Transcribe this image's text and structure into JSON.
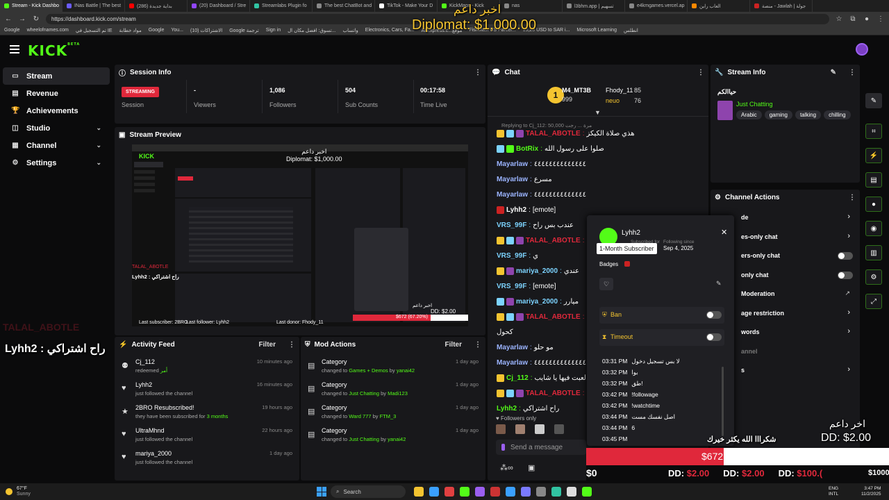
{
  "browser": {
    "tabs": [
      {
        "label": "Stream - Kick Dashbo",
        "color": "#53fc18"
      },
      {
        "label": "INas Battle | The best",
        "color": "#6b5cff"
      },
      {
        "label": "(286) بداية جديدة",
        "color": "#ff0000"
      },
      {
        "label": "(20) Dashboard / Stre",
        "color": "#9146ff"
      },
      {
        "label": "Streamlabs Plugin fo",
        "color": "#31c3a2"
      },
      {
        "label": "The best ChatBot and",
        "color": "#888888"
      },
      {
        "label": "TikTok - Make Your D",
        "color": "#ffffff"
      },
      {
        "label": "KickMaps - Kick",
        "color": "#53fc18"
      },
      {
        "label": "nas",
        "color": "#888888"
      },
      {
        "label": "l3bhm.app | تسهيم",
        "color": "#888888"
      },
      {
        "label": "e4kmgames.vercel.ap",
        "color": "#888888"
      },
      {
        "label": "العاب راين",
        "color": "#ff8800"
      },
      {
        "label": "منصة - Jawlah | جولة",
        "color": "#cc2222"
      }
    ],
    "url": "https://dashboard.kick.com/stream",
    "bookmarks": [
      "Google",
      "wheelofnames.com",
      "تم التسجيل في IE",
      "مواد خطابة",
      "Google",
      "You...",
      "الاشتراكات (10)",
      "Google ترجمة",
      "Sign in",
      "تسوق: افضل مكان ال...",
      "واتساب",
      "Electronics, Cars, Fa...",
      "AliExpress.c...موقع",
      "Fishsfast US Parcel...",
      "15,28 USD to SAR i...",
      "Microsoft Learning",
      "انطلس"
    ]
  },
  "overlay": {
    "donation_top_name": "اخبر داعم",
    "donation_top_amount": "Diplomat: $1,000.00",
    "left_faded": "TALAL_ABOTLE",
    "left_sub_msg": "Lyhh2 : راح اشتراكي",
    "right_label": "اخر داعم",
    "right_amount": "DD: $2.00",
    "thanks": "شكرااا الله يكثر خيرك",
    "goal": "$672 (67.20%)",
    "goal_fraction": 0.672,
    "goal_start": "$0",
    "goal_end": "$1000",
    "ticker": [
      {
        "name": "DD:",
        "amount": "$2.00"
      },
      {
        "name": "DD:",
        "amount": "$2.00"
      },
      {
        "name": "DD:",
        "amount": "$100.("
      }
    ]
  },
  "sidebar": {
    "items": [
      {
        "label": "Stream",
        "icon": "stream-icon",
        "glyph": "▭"
      },
      {
        "label": "Revenue",
        "icon": "revenue-icon",
        "glyph": "▤"
      },
      {
        "label": "Achievements",
        "icon": "trophy-icon",
        "glyph": "🏆"
      },
      {
        "label": "Studio",
        "icon": "studio-icon",
        "glyph": "◫"
      },
      {
        "label": "Channel",
        "icon": "channel-icon",
        "glyph": "▦"
      },
      {
        "label": "Settings",
        "icon": "gear-icon",
        "glyph": "⚙"
      }
    ]
  },
  "session": {
    "title": "Session Info",
    "status": "STREAMING",
    "session_label": "Session",
    "stats": [
      {
        "value": "-",
        "label": "Viewers"
      },
      {
        "value": "1,086",
        "label": "Followers"
      },
      {
        "value": "504",
        "label": "Sub Counts"
      },
      {
        "value": "00:17:58",
        "label": "Time Live"
      }
    ]
  },
  "preview": {
    "title": "Stream Preview",
    "inner_top": "اخبر داعم\nDiplomat: $1,000.00",
    "inner_follower": "Last follower: Lyhh2",
    "inner_donor": "Last donor: Fhody_11",
    "inner_sub": "Last subscriber: 2BRO",
    "inner_goal": "$672 (67.20%)",
    "inner_dd": "DD: $2.00",
    "inner_name": "اخبر داعم",
    "inner_left_user": "TALAL_ABOTLE",
    "inner_lyhh": "Lyhh2 : راح اشتراكي"
  },
  "activity": {
    "title": "Activity Feed",
    "filter": "Filter",
    "items": [
      {
        "name": "Cj_112",
        "sub": "redeemed",
        "extra": "أمر",
        "time": "10 minutes ago",
        "icon": "redeem-icon",
        "glyph": "⚉"
      },
      {
        "name": "Lyhh2",
        "sub": "just followed the channel",
        "extra": "",
        "time": "16 minutes ago",
        "icon": "heart-icon",
        "glyph": "♥"
      },
      {
        "name": "2BRO Resubscribed!",
        "sub": "they have been subscribed for",
        "extra": "3 months",
        "time": "19 hours ago",
        "icon": "star-icon",
        "glyph": "★"
      },
      {
        "name": "UltraMhnd",
        "sub": "just followed the channel",
        "extra": "",
        "time": "22 hours ago",
        "icon": "heart-icon",
        "glyph": "♥"
      },
      {
        "name": "mariya_2000",
        "sub": "just followed the channel",
        "extra": "",
        "time": "1 day ago",
        "icon": "heart-icon",
        "glyph": "♥"
      }
    ]
  },
  "mod": {
    "title": "Mod Actions",
    "filter": "Filter",
    "items": [
      {
        "name": "Category",
        "pre": "changed to",
        "cat": "Games + Demos",
        "by": "by",
        "user": "yanai42",
        "time": "1 day ago"
      },
      {
        "name": "Category",
        "pre": "changed to",
        "cat": "Just Chatting",
        "by": "by",
        "user": "Madi123",
        "time": "1 day ago"
      },
      {
        "name": "Category",
        "pre": "changed to",
        "cat": "Ward 777",
        "by": "by",
        "user": "FTM_3",
        "time": "1 day ago"
      },
      {
        "name": "Category",
        "pre": "changed to",
        "cat": "Just Chatting",
        "by": "by",
        "user": "yanai42",
        "time": "1 day ago"
      }
    ]
  },
  "chat": {
    "title": "Chat",
    "leaders": [
      {
        "name": "M4_MT3B",
        "value": "999"
      },
      {
        "name": "Fhody_11",
        "value": "85"
      },
      {
        "name": "neuo",
        "value": "76"
      }
    ],
    "reply": "Replying to Cj_112: 50,000 مرة ... رجت",
    "messages": [
      {
        "user": "TALAL_ABOTLE",
        "color": "#e0283b",
        "badges": [
          "#f4c430",
          "#7cd3ff",
          "#8e44ad"
        ],
        "text": "هذي صلاة الكيكز"
      },
      {
        "user": "BotRix",
        "color": "#53fc18",
        "badges": [
          "#7cd3ff",
          "#53fc18"
        ],
        "text": "صلوا على رسول الله"
      },
      {
        "user": "Mayarlaw",
        "color": "#9bb4ff",
        "badges": [],
        "text": "٤٤٤٤٤٤٤٤٤٤٤٤٤٤"
      },
      {
        "user": "Mayarlaw",
        "color": "#9bb4ff",
        "badges": [],
        "text": "مسرع"
      },
      {
        "user": "Mayarlaw",
        "color": "#9bb4ff",
        "badges": [],
        "text": "٤٤٤٤٤٤٤٤٤٤٤٤٤٤"
      },
      {
        "user": "Lyhh2",
        "color": "#ffffff",
        "badges": [
          "#cc2222"
        ],
        "text": "[emote]"
      },
      {
        "user": "VRS_99F",
        "color": "#7cd3ff",
        "badges": [],
        "text": "عندب بس راح"
      },
      {
        "user": "TALAL_ABOTLE",
        "color": "#e0283b",
        "badges": [
          "#f4c430",
          "#7cd3ff",
          "#8e44ad"
        ],
        "text": ""
      },
      {
        "user": "VRS_99F",
        "color": "#7cd3ff",
        "badges": [],
        "text": "ي"
      },
      {
        "user": "mariya_2000",
        "color": "#7cd3ff",
        "badges": [
          "#f4c430",
          "#8e44ad"
        ],
        "text": "عندي"
      },
      {
        "user": "VRS_99F",
        "color": "#7cd3ff",
        "badges": [],
        "text": "[emote]"
      },
      {
        "user": "mariya_2000",
        "color": "#7cd3ff",
        "badges": [
          "#7cd3ff",
          "#8e44ad"
        ],
        "text": "ميارر"
      },
      {
        "user": "TALAL_ABOTLE",
        "color": "#e0283b",
        "badges": [
          "#f4c430",
          "#7cd3ff",
          "#8e44ad"
        ],
        "text": ""
      },
      {
        "user": "",
        "color": "#ffffff",
        "badges": [],
        "text": "كحول"
      },
      {
        "user": "Mayarlaw",
        "color": "#9bb4ff",
        "badges": [],
        "text": "مو حلو"
      },
      {
        "user": "Mayarlaw",
        "color": "#9bb4ff",
        "badges": [],
        "text": "٤٤٤٤٤٤٤٤٤٤٤٤٤٤"
      },
      {
        "user": "Cj_112",
        "color": "#53fc18",
        "badges": [
          "#f4c430"
        ],
        "text": "لعبت فيها يا شايب"
      },
      {
        "user": "TALAL_ABOTLE",
        "color": "#e0283b",
        "badges": [
          "#f4c430",
          "#7cd3ff",
          "#8e44ad"
        ],
        "text": ""
      },
      {
        "user": "Lyhh2",
        "color": "#53fc18",
        "badges": [],
        "text": "راح اشتراكي"
      }
    ],
    "followers_only": "Followers only",
    "placeholder": "Send a message"
  },
  "popup": {
    "username": "Lyhh2",
    "subscribed_for": "Subscribed for",
    "following_since_label": "Following since",
    "following_since": "Sep 4, 2025",
    "tooltip": "1-Month Subscriber",
    "badges_label": "Badges",
    "ban": "Ban",
    "timeout": "Timeout",
    "log": [
      {
        "time": "03:31 PM",
        "text": "لا بس تسجيل دخول"
      },
      {
        "time": "03:32 PM",
        "text": "بوا"
      },
      {
        "time": "03:32 PM",
        "text": "طق!"
      },
      {
        "time": "03:42 PM",
        "text": "!followage"
      },
      {
        "time": "03:42 PM",
        "text": "!watchtime"
      },
      {
        "time": "03:44 PM",
        "text": "اصل نفسك مست"
      },
      {
        "time": "03:44 PM",
        "text": "6"
      },
      {
        "time": "03:45 PM",
        "text": ""
      }
    ]
  },
  "streaminfo": {
    "title": "Stream Info",
    "stream_title": "حياالكم",
    "category": "Just Chatting",
    "tags": [
      "Arabic",
      "gaming",
      "talking",
      "chilling"
    ]
  },
  "actions": {
    "title": "Channel Actions",
    "items": [
      {
        "label": "de",
        "control": "chevron"
      },
      {
        "label": "es-only chat",
        "control": "chevron"
      },
      {
        "label": "ers-only chat",
        "control": "toggle"
      },
      {
        "label": "only chat",
        "control": "toggle"
      },
      {
        "label": "Moderation",
        "control": "external"
      },
      {
        "label": "age restriction",
        "control": "chevron"
      },
      {
        "label": "words",
        "control": "chevron"
      },
      {
        "label": "annel",
        "control": "none"
      },
      {
        "label": "s",
        "control": "chevron"
      }
    ]
  },
  "taskbar": {
    "search": "Search",
    "lang1": "ENG",
    "lang2": "INTL",
    "time": "3:47 PM",
    "date": "11/2/2025",
    "weather": "67°F",
    "weather_desc": "Sunny"
  },
  "colors": {
    "kick_green": "#53fc18",
    "streaming_red": "#e0283b",
    "panel": "#18181b",
    "bg": "#0b0b0c"
  }
}
